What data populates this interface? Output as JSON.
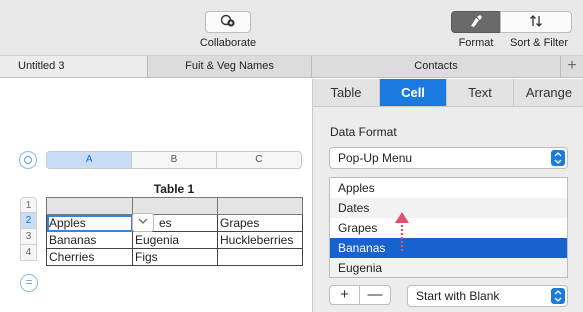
{
  "toolbar": {
    "collaborate_label": "Collaborate",
    "format_label": "Format",
    "sort_filter_label": "Sort & Filter"
  },
  "sheet_tabs": [
    {
      "label": "Untitled 3"
    },
    {
      "label": "Fuit & Veg Names"
    },
    {
      "label": "Contacts"
    }
  ],
  "sheet_tab_add": "+",
  "table": {
    "title": "Table 1",
    "columns": [
      "A",
      "B",
      "C"
    ],
    "row_numbers": [
      "1",
      "2",
      "3",
      "4"
    ],
    "rows": [
      [
        "",
        "",
        ""
      ],
      [
        "Apples",
        "es",
        "Grapes"
      ],
      [
        "Bananas",
        "Eugenia",
        "Huckleberries"
      ],
      [
        "Cherries",
        "Figs",
        ""
      ]
    ]
  },
  "inspector": {
    "tabs": [
      "Table",
      "Cell",
      "Text",
      "Arrange"
    ],
    "active_tab": "Cell",
    "data_format_label": "Data Format",
    "data_format_value": "Pop-Up Menu",
    "popup_items": [
      "Apples",
      "Dates",
      "Grapes",
      "Bananas",
      "Eugenia"
    ],
    "selected_item": "Bananas",
    "add_label": "+",
    "remove_label": "—",
    "start_with_value": "Start with Blank"
  },
  "colors": {
    "accent": "#1a7ae0",
    "selection": "#1862cf",
    "arrow": "#e0506a"
  }
}
